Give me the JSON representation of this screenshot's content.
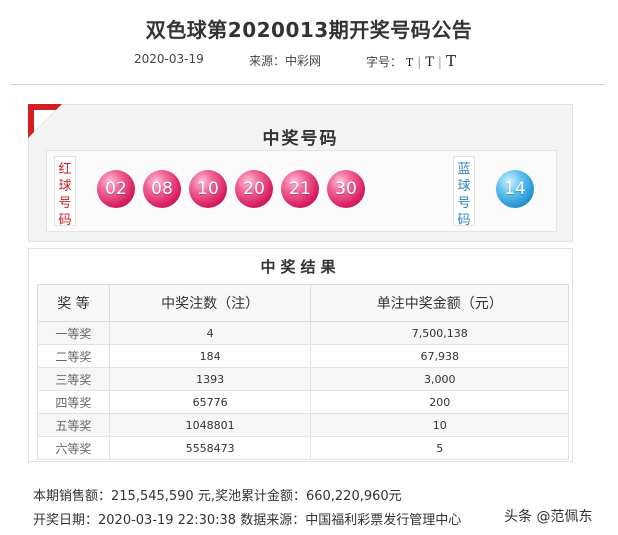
{
  "header": {
    "title": "双色球第2020013期开奖号码公告",
    "date": "2020-03-19",
    "source_label": "来源：中彩网",
    "font_size_label": "字号：",
    "font_size_options": [
      "T",
      "T",
      "T"
    ],
    "separator": "|"
  },
  "draw": {
    "section_title": "中奖号码",
    "red_label": "红球号码",
    "blue_label": "蓝球号码",
    "red_balls": [
      "02",
      "08",
      "10",
      "20",
      "21",
      "30"
    ],
    "blue_ball": "14"
  },
  "results": {
    "section_title": "中奖结果",
    "headers": [
      "奖 等",
      "中奖注数（注）",
      "单注中奖金额（元）"
    ],
    "rows": [
      {
        "grade": "一等奖",
        "count": "4",
        "amount": "7,500,138"
      },
      {
        "grade": "二等奖",
        "count": "184",
        "amount": "67,938"
      },
      {
        "grade": "三等奖",
        "count": "1393",
        "amount": "3,000"
      },
      {
        "grade": "四等奖",
        "count": "65776",
        "amount": "200"
      },
      {
        "grade": "五等奖",
        "count": "1048801",
        "amount": "10"
      },
      {
        "grade": "六等奖",
        "count": "5558473",
        "amount": "5"
      }
    ]
  },
  "footer": {
    "summary": "本期销售额：215,545,590 元,奖池累计金额：660,220,960元",
    "draw_info": "开奖日期：2020-03-19 22:30:38 数据来源：中国福利彩票发行管理中心"
  },
  "watermark": {
    "text": "头条 @范佩东"
  },
  "colors": {
    "red_ball": "#d81b60",
    "blue_ball": "#1f8fd0",
    "red_label": "#d41e22",
    "blue_label": "#2a85c8"
  }
}
